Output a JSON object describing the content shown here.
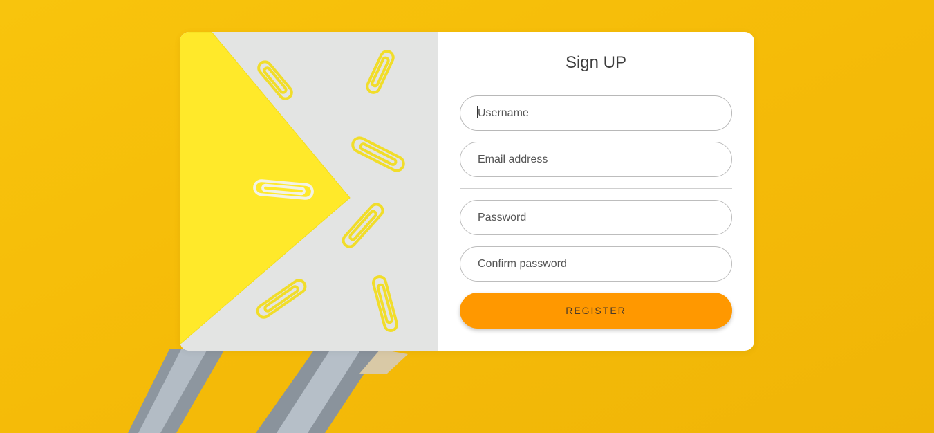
{
  "form": {
    "title": "Sign UP",
    "fields": [
      {
        "placeholder": "Username",
        "value": ""
      },
      {
        "placeholder": "Email address",
        "value": ""
      },
      {
        "placeholder": "Password",
        "value": ""
      },
      {
        "placeholder": "Confirm password",
        "value": ""
      }
    ],
    "register_label": "REGISTER"
  },
  "colors": {
    "background": "#f6bd0a",
    "card": "#ffffff",
    "button": "#ff9800",
    "image_yellow": "#ffe92a",
    "image_gray": "#e3e4e3"
  }
}
